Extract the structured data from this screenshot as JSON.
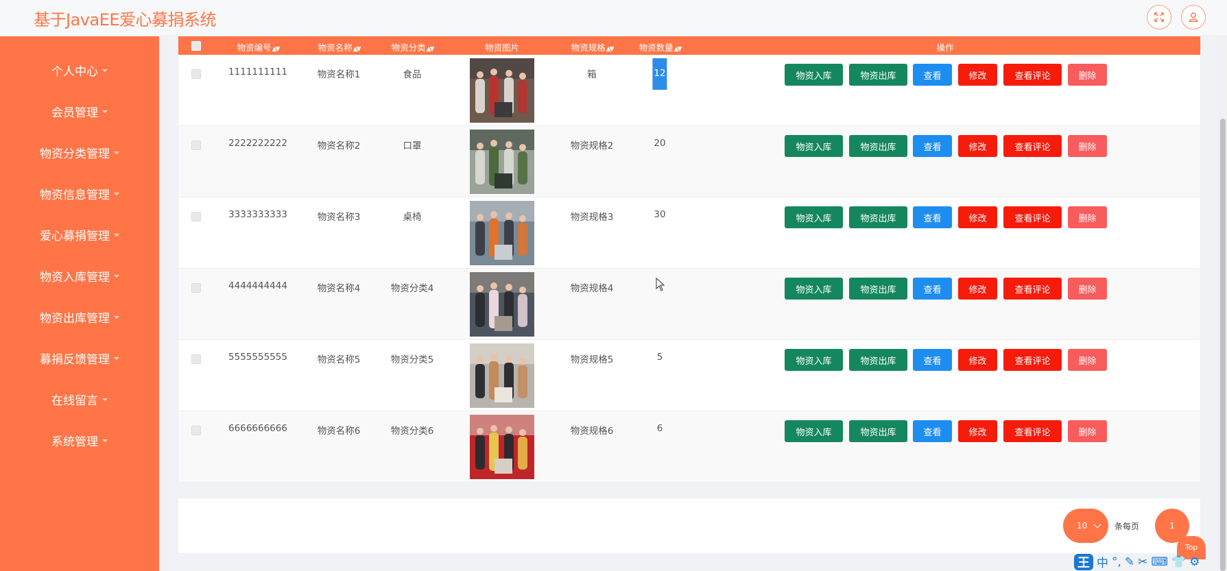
{
  "app": {
    "title": "基于JavaEE爱心募捐系统"
  },
  "header": {
    "fullscreen_icon": "fullscreen-icon",
    "user_icon": "user-icon"
  },
  "sidebar": {
    "items": [
      {
        "label": "个人中心"
      },
      {
        "label": "会员管理"
      },
      {
        "label": "物资分类管理"
      },
      {
        "label": "物资信息管理"
      },
      {
        "label": "爱心募捐管理"
      },
      {
        "label": "物资入库管理"
      },
      {
        "label": "物资出库管理"
      },
      {
        "label": "募捐反馈管理"
      },
      {
        "label": "在线留言"
      },
      {
        "label": "系统管理"
      }
    ]
  },
  "table": {
    "columns": {
      "code": "物资编号",
      "name": "物资名称",
      "category": "物资分类",
      "image": "物资图片",
      "spec": "物资规格",
      "quantity": "物资数量",
      "actions": "操作"
    },
    "actions": {
      "stock_in": "物资入库",
      "stock_out": "物资出库",
      "view": "查看",
      "edit": "修改",
      "comments": "查看评论",
      "delete": "删除"
    },
    "rows": [
      {
        "code": "1111111111",
        "name": "物资名称1",
        "category": "食品",
        "spec": "箱",
        "quantity": "12",
        "highlighted": true,
        "photo_colors": [
          "#6e5a4e",
          "#b8332f",
          "#d9d4cd",
          "#3c3a3f"
        ]
      },
      {
        "code": "2222222222",
        "name": "物资名称2",
        "category": "口罩",
        "spec": "物资规格2",
        "quantity": "20",
        "photo_colors": [
          "#9aa39a",
          "#4c6a3a",
          "#d6d8d0",
          "#2f3a30"
        ]
      },
      {
        "code": "3333333333",
        "name": "物资名称3",
        "category": "桌椅",
        "spec": "物资规格3",
        "quantity": "30",
        "photo_colors": [
          "#7a8a96",
          "#e0722d",
          "#3d4048",
          "#c9ccd0"
        ]
      },
      {
        "code": "4444444444",
        "name": "物资名称4",
        "category": "物资分类4",
        "spec": "物资规格4",
        "quantity": "",
        "photo_colors": [
          "#4d5560",
          "#ead7dc",
          "#2c2e33",
          "#a59a8e"
        ]
      },
      {
        "code": "5555555555",
        "name": "物资名称5",
        "category": "物资分类5",
        "spec": "物资规格5",
        "quantity": "5",
        "photo_colors": [
          "#b8b3ac",
          "#c48a5c",
          "#2e2f33",
          "#eae6de"
        ]
      },
      {
        "code": "6666666666",
        "name": "物资名称6",
        "category": "物资分类6",
        "spec": "物资规格6",
        "quantity": "6",
        "photo_colors": [
          "#c0252a",
          "#e7c64d",
          "#2d2b2e",
          "#d8cfc4"
        ]
      }
    ]
  },
  "pager": {
    "page_size": "10",
    "per_page_label": "条每页",
    "current_page": "1",
    "top_label": "Top"
  },
  "ime": {
    "logo": "王",
    "mode": "中",
    "items": [
      "°,",
      "✎",
      "✂",
      "⌨",
      "👕",
      "⚙"
    ]
  },
  "colors": {
    "accent": "#ff7547",
    "green": "#15875f",
    "blue": "#1e8df0",
    "red": "#f51c0c",
    "light_red": "#f85c5c"
  }
}
